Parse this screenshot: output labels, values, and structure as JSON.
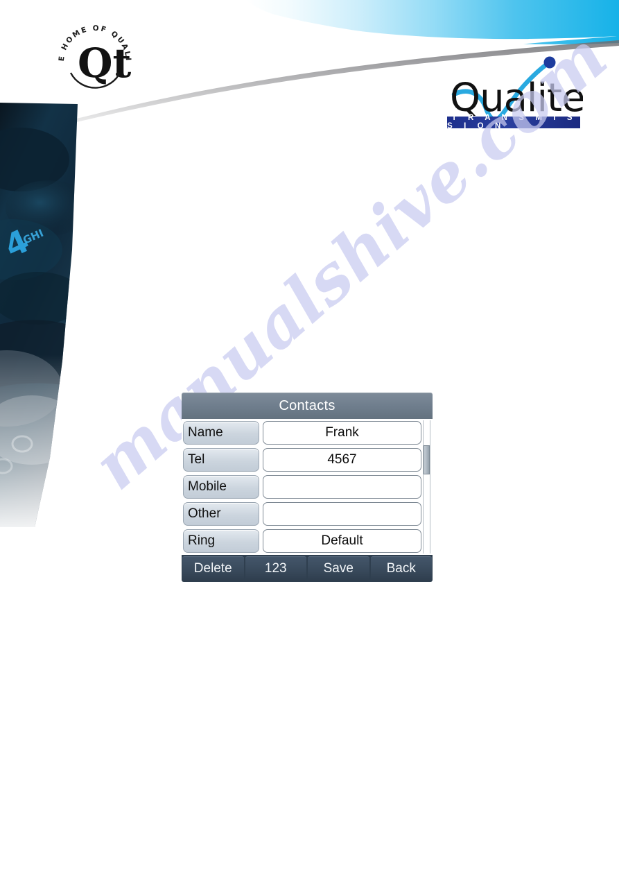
{
  "brand": {
    "seal": {
      "ring_text": "THE HOME OF QUALITY",
      "monogram": "Qt"
    },
    "logo": {
      "wordmark": "Qualitel",
      "tagline": "T R A N S M I S S I O N",
      "accent_color": "#29a9e0",
      "dot_color": "#1d3c9e",
      "bar_color": "#1d2f8c"
    },
    "band_color": "#22b5e8"
  },
  "watermark": {
    "text": "manualshive.com",
    "color": "#c9cbf0"
  },
  "phone_screen": {
    "title": "Contacts",
    "fields": [
      {
        "label": "Name",
        "value": "Frank"
      },
      {
        "label": "Tel",
        "value": "4567"
      },
      {
        "label": "Mobile",
        "value": ""
      },
      {
        "label": "Other",
        "value": ""
      },
      {
        "label": "Ring",
        "value": "Default"
      }
    ],
    "softkeys": [
      {
        "label": "Delete"
      },
      {
        "label": "123"
      },
      {
        "label": "Save"
      },
      {
        "label": "Back"
      }
    ]
  }
}
